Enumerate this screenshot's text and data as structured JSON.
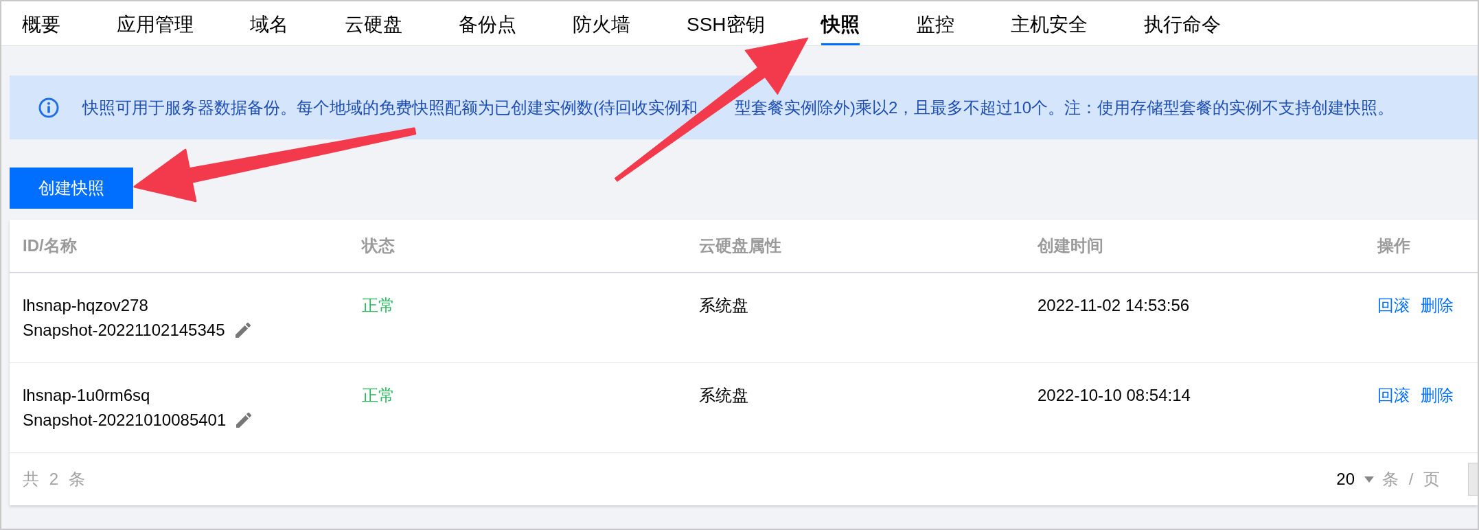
{
  "tabs": [
    {
      "label": "概要",
      "selected": false
    },
    {
      "label": "应用管理",
      "selected": false
    },
    {
      "label": "域名",
      "selected": false
    },
    {
      "label": "云硬盘",
      "selected": false
    },
    {
      "label": "备份点",
      "selected": false
    },
    {
      "label": "防火墙",
      "selected": false
    },
    {
      "label": "SSH密钥",
      "selected": false
    },
    {
      "label": "快照",
      "selected": true
    },
    {
      "label": "监控",
      "selected": false
    },
    {
      "label": "主机安全",
      "selected": false
    },
    {
      "label": "执行命令",
      "selected": false
    }
  ],
  "notice": {
    "segments": [
      "快照可用于服务器数据备份。每个地域的免费快照配额为已创建实例数(待回收实例和",
      "型套餐实例除外)乘以2，且最多不超过10个。注：使用存储型套餐的实例不支持创建快照。"
    ]
  },
  "create_button": {
    "label": "创建快照"
  },
  "table": {
    "columns": [
      "ID/名称",
      "状态",
      "云硬盘属性",
      "创建时间",
      "操作"
    ],
    "rows": [
      {
        "id": "lhsnap-hqzov278",
        "name": "Snapshot-20221102145345",
        "status": "正常",
        "disk": "系统盘",
        "created": "2022-11-02 14:53:56",
        "actions": [
          "回滚",
          "删除"
        ]
      },
      {
        "id": "lhsnap-1u0rm6sq",
        "name": "Snapshot-20221010085401",
        "status": "正常",
        "disk": "系统盘",
        "created": "2022-10-10 08:54:14",
        "actions": [
          "回滚",
          "删除"
        ]
      }
    ]
  },
  "pagination": {
    "total": "共 2 条",
    "page_size": "20",
    "unit": "条 / 页"
  }
}
